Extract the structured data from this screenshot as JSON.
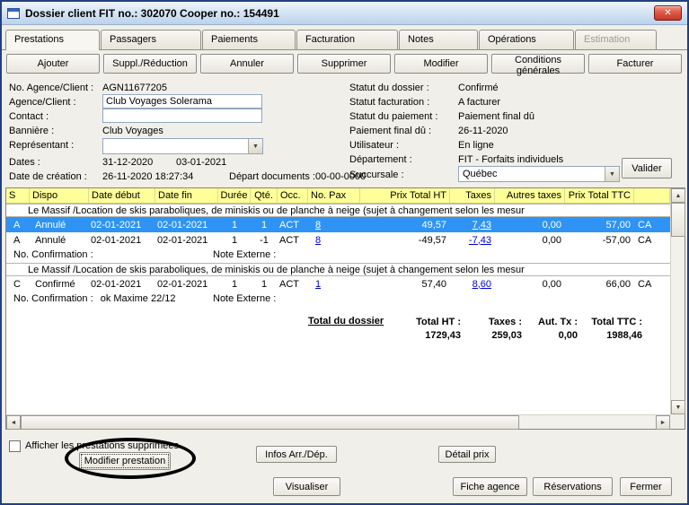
{
  "window": {
    "title": "Dossier client FIT no.: 302070  Cooper no.: 154491",
    "close_glyph": "✕"
  },
  "tabs": [
    "Prestations",
    "Passagers",
    "Paiements",
    "Facturation",
    "Notes",
    "Opérations",
    "Estimation"
  ],
  "actions": [
    "Ajouter",
    "Suppl./Réduction",
    "Annuler",
    "Supprimer",
    "Modifier",
    "Conditions générales",
    "Facturer"
  ],
  "form_left": {
    "agency_no_label": "No. Agence/Client :",
    "agency_no_value": "AGN11677205",
    "agency_label": "Agence/Client :",
    "agency_value": "Club Voyages Solerama",
    "contact_label": "Contact :",
    "contact_value": "",
    "banner_label": "Bannière :",
    "banner_value": "Club Voyages",
    "rep_label": "Représentant :",
    "rep_value": "",
    "dates_label": "Dates :",
    "date_start": "31-12-2020",
    "date_end": "03-01-2021",
    "created_label": "Date de création :",
    "created_value": "26-11-2020 18:27:34",
    "docs_label": "Départ documents :",
    "docs_value": "00-00-0000"
  },
  "form_right": {
    "file_status_label": "Statut du dossier :",
    "file_status_value": "Confirmé",
    "billing_status_label": "Statut facturation :",
    "billing_status_value": "A facturer",
    "payment_status_label": "Statut du paiement :",
    "payment_status_value": "Paiement final dû",
    "final_payment_label": "Paiement final dû :",
    "final_payment_value": "26-11-2020",
    "user_label": "Utilisateur :",
    "user_value": "En ligne",
    "dept_label": "Département :",
    "dept_value": "FIT - Forfaits individuels",
    "branch_label": "Succursale :",
    "branch_value": "Québec",
    "validate_button": "Valider"
  },
  "table": {
    "headers": [
      "S",
      "Dispo",
      "Date début",
      "Date fin",
      "Durée",
      "Qté.",
      "Occ.",
      "No. Pax",
      "Prix Total HT",
      "Taxes",
      "Autres taxes",
      "Prix Total TTC"
    ],
    "group1_desc": "Le Massif /Location de skis paraboliques, de miniskis ou de planche à neige (sujet à changement selon les mesur",
    "row1": {
      "s": "A",
      "dispo": "Annulé",
      "start": "02-01-2021",
      "end": "02-01-2021",
      "duration": "1",
      "qty": "1",
      "occ": "ACT",
      "pax": "8",
      "total_ht": "49,57",
      "taxes": "7,43",
      "other_taxes": "0,00",
      "total_ttc": "57,00",
      "currency": "CA"
    },
    "row2": {
      "s": "A",
      "dispo": "Annulé",
      "start": "02-01-2021",
      "end": "02-01-2021",
      "duration": "1",
      "qty": "-1",
      "occ": "ACT",
      "pax": "8",
      "total_ht": "-49,57",
      "taxes": "-7,43",
      "other_taxes": "0,00",
      "total_ttc": "-57,00",
      "currency": "CA"
    },
    "group1_confirmation_label": "No. Confirmation :",
    "group1_confirmation_value": "",
    "group1_note_label": "Note Externe :",
    "group2_desc": "Le Massif /Location de skis paraboliques, de miniskis ou de planche à neige (sujet à changement selon les mesur",
    "row3": {
      "s": "C",
      "dispo": "Confirmé",
      "start": "02-01-2021",
      "end": "02-01-2021",
      "duration": "1",
      "qty": "1",
      "occ": "ACT",
      "pax": "1",
      "total_ht": "57,40",
      "taxes": "8,60",
      "other_taxes": "0,00",
      "total_ttc": "66,00",
      "currency": "CA"
    },
    "group2_confirmation_label": "No. Confirmation :",
    "group2_confirmation_value": "ok Maxime 22/12",
    "group2_note_label": "Note Externe :",
    "totals": {
      "title": "Total du dossier",
      "ht_label": "Total HT :",
      "ht_value": "1729,43",
      "taxes_label": "Taxes :",
      "taxes_value": "259,03",
      "aut_label": "Aut. Tx :",
      "aut_value": "0,00",
      "ttc_label": "Total TTC :",
      "ttc_value": "1988,46"
    }
  },
  "footer": {
    "show_deleted_label": "Afficher les prestations supprimées",
    "modifier_prestation": "Modifier prestation",
    "infos_arr_dep": "Infos Arr./Dép.",
    "detail_prix": "Détail prix",
    "visualiser": "Visualiser",
    "fiche_agence": "Fiche agence",
    "reservations": "Réservations",
    "fermer": "Fermer"
  },
  "colors": {
    "header_yellow": "#ffff99",
    "selection_blue": "#2e93f5",
    "link_blue": "#0000cc",
    "close_red": "#c03a28",
    "annotation_black": "#000000"
  }
}
